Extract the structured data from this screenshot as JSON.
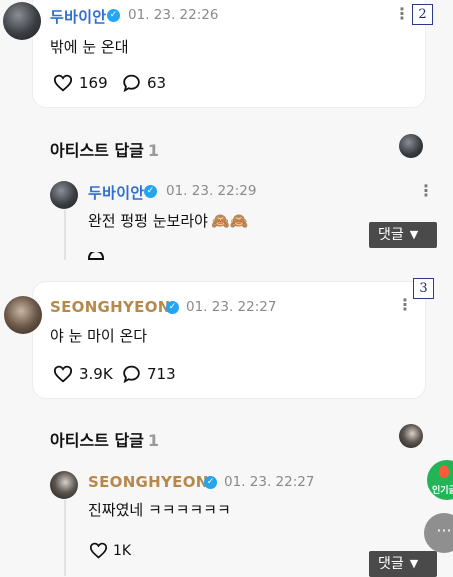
{
  "posts": [
    {
      "author": "두바이안",
      "date": "01. 23. 22:26",
      "text": "밖에 눈 온대",
      "likes": "169",
      "comments": "63",
      "tag": "2"
    },
    {
      "author": "SEONGHYEON",
      "date": "01. 23. 22:27",
      "text": "야 눈 마이 온다",
      "likes": "3.9K",
      "comments": "713",
      "tag": "3"
    }
  ],
  "artist_replies": [
    {
      "section_title": "아티스트 답글",
      "count": "1",
      "reply": {
        "author": "두바이안",
        "date": "01. 23. 22:29",
        "text": "완전 펑펑 눈보라야",
        "emoji": "🙈🙈"
      },
      "reply_button": "댓글"
    },
    {
      "section_title": "아티스트 답글",
      "count": "1",
      "reply": {
        "author": "SEONGHYEON",
        "date": "01. 23. 22:27",
        "text": "진짜였네 ㅋㅋㅋㅋㅋㅋ",
        "likes": "1K"
      },
      "reply_button": "댓글"
    }
  ],
  "floating": {
    "popular_label": "인기글"
  },
  "colors": {
    "blue_name": "#2f6fd0",
    "gold_name": "#b5894a",
    "verified": "#25a4f0",
    "fab_green": "#22b455"
  }
}
